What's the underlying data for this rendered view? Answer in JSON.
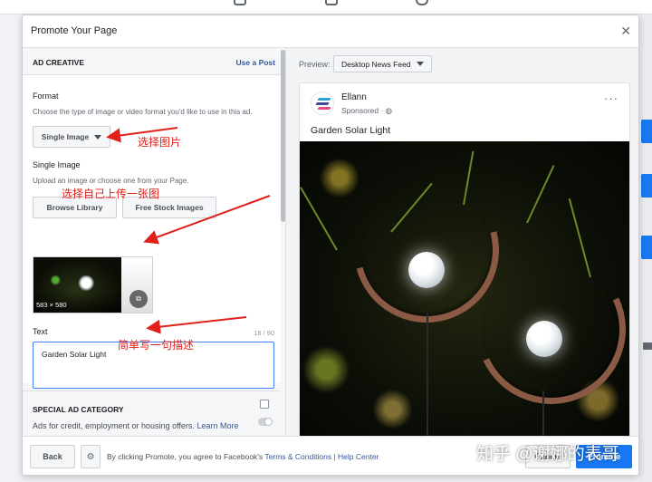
{
  "modal": {
    "title": "Promote Your Page"
  },
  "creative": {
    "section_title": "AD CREATIVE",
    "use_post": "Use a Post",
    "format_label": "Format",
    "format_hint": "Choose the type of image or video format you'd like to use in this ad.",
    "format_value": "Single Image",
    "single_label": "Single Image",
    "single_hint": "Upload an image or choose one from your Page.",
    "browse_label": "Browse Library",
    "stock_label": "Free Stock Images",
    "thumb_dim": "583 × 580",
    "text_label": "Text",
    "text_count": "18 / 90",
    "text_value": "Garden Solar Light"
  },
  "special": {
    "title": "SPECIAL AD CATEGORY",
    "note": "Ads for credit, employment or housing offers.",
    "learn_more": "Learn More"
  },
  "preview": {
    "label": "Preview:",
    "placement": "Desktop News Feed",
    "page_name": "Ellann",
    "sponsored": "Sponsored · ",
    "post_text": "Garden Solar Light",
    "more": "···"
  },
  "footer": {
    "back": "Back",
    "terms_prefix": "By clicking Promote, you agree to Facebook's ",
    "terms_link": "Terms & Conditions",
    "separator": " | ",
    "help": "Help Center",
    "cancel": "Cancel",
    "promote": "Promote"
  },
  "annotations": {
    "choose_image": "选择图片",
    "upload_image": "选择自己上传一张图",
    "describe": "简单写一句描述"
  },
  "watermark": "知乎 @谢娜的表哥",
  "colors": {
    "accent": "#1877f2",
    "annotation": "#e0201b",
    "link": "#385898"
  },
  "icons": [
    "close-icon",
    "caret-down-icon",
    "crop-edit-icon",
    "gear-icon",
    "globe-icon",
    "more-icon",
    "home-icon",
    "friends-icon",
    "groups-icon"
  ]
}
